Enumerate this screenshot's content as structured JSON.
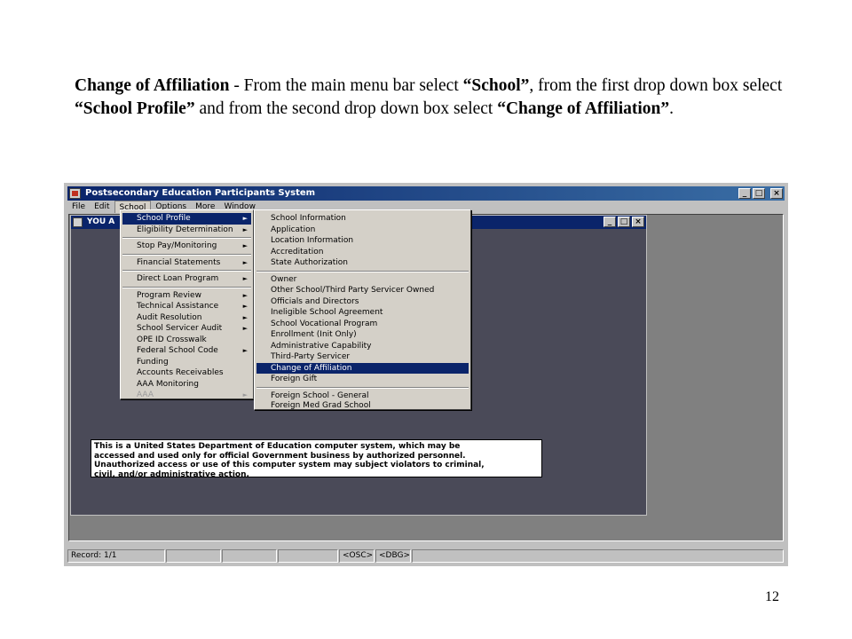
{
  "instruction": {
    "lead": "Change of Affiliation",
    "text1": " - From the main menu bar select ",
    "school": "“School”",
    "text2": ", from the first drop down box select ",
    "school_profile": "“School Profile”",
    "text3": " and from the second drop down box select ",
    "change_of_affiliation": "“Change of Affiliation”",
    "text4": "."
  },
  "page_number": "12",
  "app": {
    "title": "Postsecondary Education Participants System",
    "window_buttons": {
      "minimize": "_",
      "maximize": "□",
      "close": "×"
    }
  },
  "menu_bar": [
    "File",
    "Edit",
    "School",
    "Options",
    "More",
    "Window"
  ],
  "child_window": {
    "title": "YOU A"
  },
  "school_menu": {
    "items": [
      {
        "label": "School Profile",
        "arrow": "►"
      },
      {
        "label": "Eligibility Determination",
        "arrow": "►"
      },
      {
        "label": "Stop Pay/Monitoring",
        "arrow": "►"
      },
      {
        "label": "Financial Statements",
        "arrow": "►"
      },
      {
        "label": "Direct Loan Program",
        "arrow": "►"
      },
      {
        "label": "Program Review",
        "arrow": "►"
      },
      {
        "label": "Technical Assistance",
        "arrow": "►"
      },
      {
        "label": "Audit Resolution",
        "arrow": "►"
      },
      {
        "label": "School Servicer Audit",
        "arrow": "►"
      },
      {
        "label": "OPE ID Crosswalk",
        "arrow": ""
      },
      {
        "label": "Federal School Code",
        "arrow": "►"
      },
      {
        "label": "Funding",
        "arrow": ""
      },
      {
        "label": "Accounts Receivables",
        "arrow": ""
      },
      {
        "label": "AAA Monitoring",
        "arrow": ""
      },
      {
        "label": "AAA",
        "arrow": "►"
      }
    ]
  },
  "school_profile_submenu": {
    "items": [
      "School Information",
      "Application",
      "Location Information",
      "Accreditation",
      "State Authorization",
      "Owner",
      "Other School/Third Party Servicer Owned",
      "Officials and Directors",
      "Ineligible School Agreement",
      "School Vocational Program",
      "Enrollment (Init Only)",
      "Administrative Capability",
      "Third-Party Servicer",
      "Change of Affiliation",
      "Foreign Gift",
      "Foreign School - General",
      "Foreign Med Grad School"
    ]
  },
  "notice": [
    "This is a United States Department of Education computer system, which may be",
    "accessed and used only for official Government business by authorized personnel.",
    "Unauthorized access or use of this computer system may subject violators to criminal,",
    "civil, and/or administrative action."
  ],
  "status_bar": [
    "Record: 1/1",
    "",
    "",
    "",
    "<OSC>",
    "<DBG>",
    ""
  ]
}
